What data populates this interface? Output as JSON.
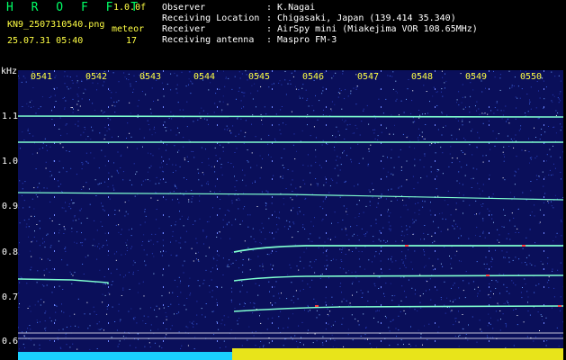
{
  "header": {
    "app_title": "H R O F F T",
    "version": "1.0.0f",
    "filename": "KN9_2507310540.png",
    "timestamp": "25.07.31 05:40",
    "meteor_label": "meteor",
    "meteor_count": "17"
  },
  "metadata": [
    {
      "key": "Observer",
      "value": ": K.Nagai"
    },
    {
      "key": "Receiving Location",
      "value": ": Chigasaki, Japan (139.414 35.340)"
    },
    {
      "key": "Receiver",
      "value": ": AirSpy mini (Miakejima VOR 108.65MHz)"
    },
    {
      "key": "Receiving antenna",
      "value": ": Maspro FM-3"
    }
  ],
  "axis": {
    "y_unit": "kHz",
    "y_ticks": [
      "1.1",
      "1.0",
      "0.9",
      "0.8",
      "0.7",
      "0.6"
    ],
    "x_ticks": [
      "0541",
      "0542",
      "0543",
      "0544",
      "0545",
      "0546",
      "0547",
      "0548",
      "0549",
      "0550"
    ]
  },
  "colors": {
    "background": "#000000",
    "spectrogram_bg": "#0a0f5a",
    "signal": "#7fffd0",
    "label_yellow": "#ffff44",
    "title_green": "#00ff66",
    "baseline_cyan": "#1ad0ff"
  }
}
